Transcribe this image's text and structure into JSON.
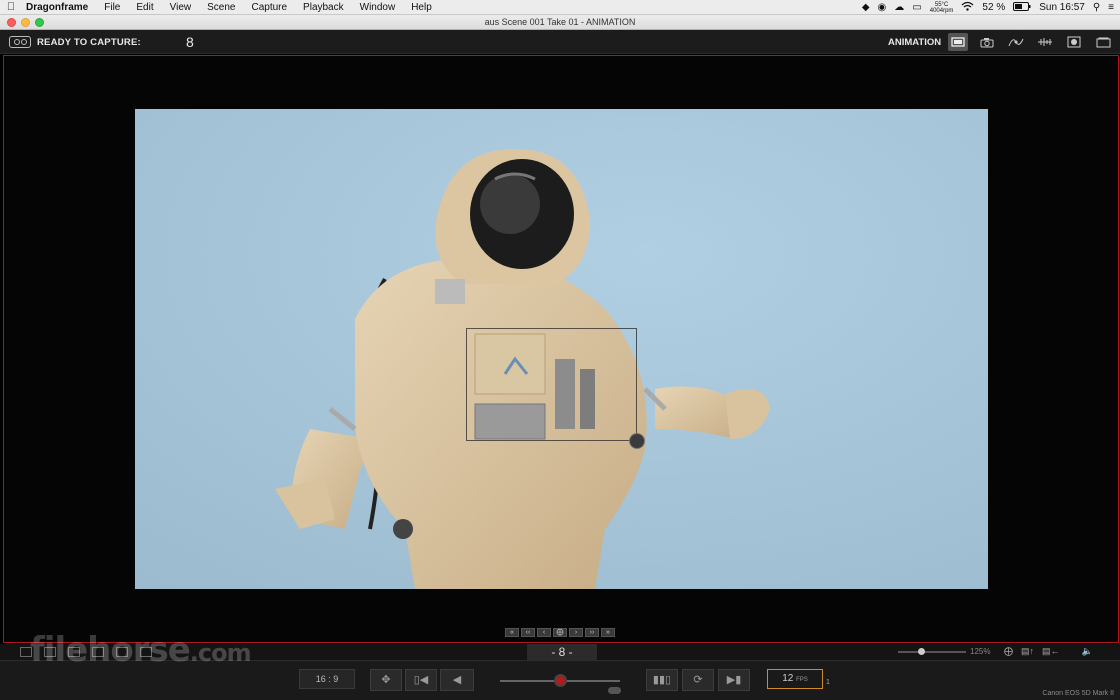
{
  "menubar": {
    "app": "Dragonframe",
    "items": [
      "File",
      "Edit",
      "View",
      "Scene",
      "Capture",
      "Playback",
      "Window",
      "Help"
    ],
    "temp": "55°C",
    "rpm": "4004rpm",
    "battery": "52 %",
    "clock": "Sun 16:57"
  },
  "window": {
    "title": "aus  Scene 001  Take 01 - ANIMATION"
  },
  "toolbar": {
    "status": "READY TO CAPTURE:",
    "frame": "8",
    "mode": "ANIMATION"
  },
  "strip": {
    "frame_display": "- 8 -",
    "zoom": "125%"
  },
  "bottom": {
    "aspect": "16 : 9",
    "fps_value": "12",
    "fps_unit": "FPS",
    "fps_sub": "1",
    "camera": "Canon EOS 5D Mark II"
  },
  "watermark": {
    "text": "filehorse",
    "suffix": ".com"
  },
  "colors": {
    "accent_border": "#b0141c",
    "fps_outline": "#d08a2c",
    "record_knob": "#b11b20"
  },
  "icons": {
    "toolbar": [
      "monitor-icon",
      "camera-icon",
      "graph-icon",
      "audio-wave-icon",
      "focus-icon",
      "cinema-icon"
    ],
    "nav": [
      "first-frame-icon",
      "prev-fast-icon",
      "prev-icon",
      "crosshair-icon",
      "next-icon",
      "next-fast-icon",
      "last-frame-icon"
    ]
  }
}
